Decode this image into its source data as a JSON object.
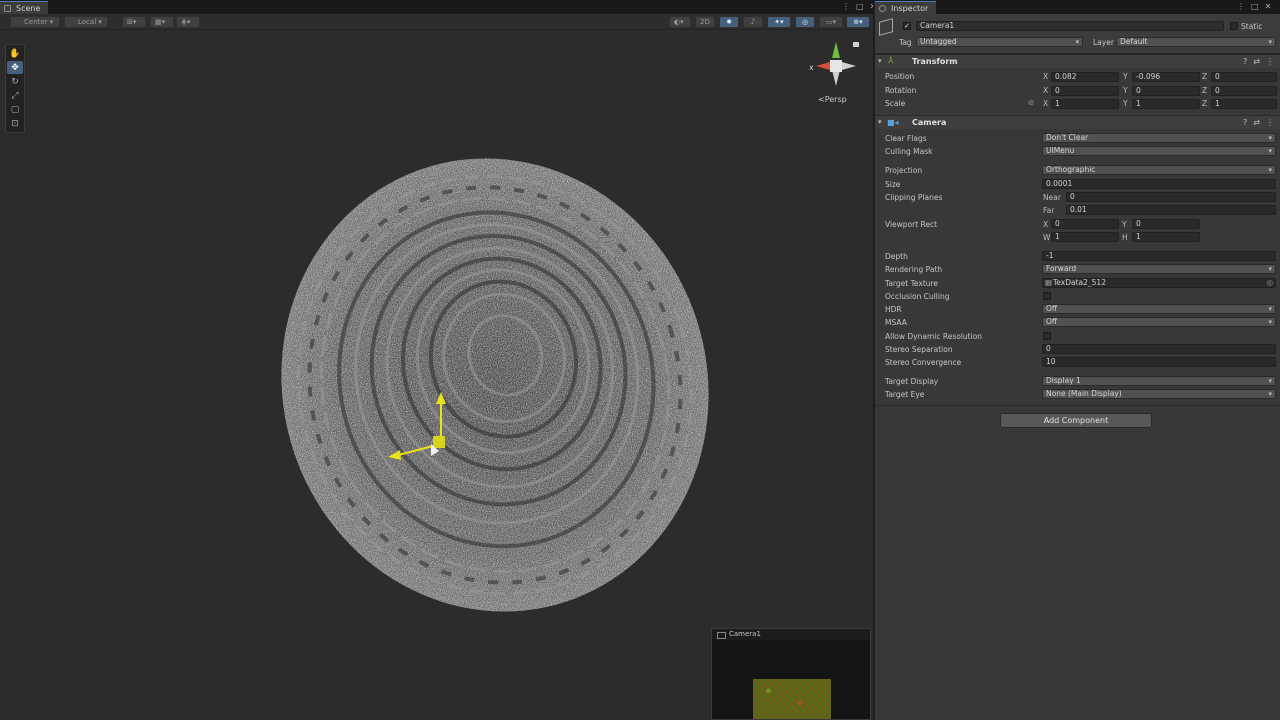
{
  "scene": {
    "tab_label": "Scene",
    "pivot_mode": "Center",
    "pivot_space": "Local",
    "btn_2d": "2D",
    "persp_label": "Persp",
    "gizmo_axis_x": "x"
  },
  "preview": {
    "title": "Camera1"
  },
  "inspector": {
    "tab_label": "Inspector",
    "object_name": "Camera1",
    "static_label": "Static",
    "tag_label": "Tag",
    "tag_value": "Untagged",
    "layer_label": "Layer",
    "layer_value": "Default",
    "transform": {
      "title": "Transform",
      "position_label": "Position",
      "rotation_label": "Rotation",
      "scale_label": "Scale",
      "position": {
        "x": "0.082",
        "y": "-0.096",
        "z": "0"
      },
      "rotation": {
        "x": "0",
        "y": "0",
        "z": "0"
      },
      "scale": {
        "x": "1",
        "y": "1",
        "z": "1"
      }
    },
    "camera": {
      "title": "Camera",
      "clear_flags_label": "Clear Flags",
      "clear_flags": "Don't Clear",
      "culling_mask_label": "Culling Mask",
      "culling_mask": "UIMenu",
      "projection_label": "Projection",
      "projection": "Orthographic",
      "size_label": "Size",
      "size": "0.0001",
      "clipping_label": "Clipping Planes",
      "near_label": "Near",
      "near": "0",
      "far_label": "Far",
      "far": "0.01",
      "viewport_label": "Viewport Rect",
      "vp_x": "0",
      "vp_y": "0",
      "vp_w": "1",
      "vp_h": "1",
      "depth_label": "Depth",
      "depth": "-1",
      "rendering_path_label": "Rendering Path",
      "rendering_path": "Forward",
      "target_texture_label": "Target Texture",
      "target_texture": "TexData2_512",
      "occlusion_label": "Occlusion Culling",
      "hdr_label": "HDR",
      "hdr": "Off",
      "msaa_label": "MSAA",
      "msaa": "Off",
      "dynres_label": "Allow Dynamic Resolution",
      "stereo_sep_label": "Stereo Separation",
      "stereo_sep": "0",
      "stereo_conv_label": "Stereo Convergence",
      "stereo_conv": "10",
      "target_display_label": "Target Display",
      "target_display": "Display 1",
      "target_eye_label": "Target Eye",
      "target_eye": "None (Main Display)"
    },
    "add_component": "Add Component"
  },
  "colors": {
    "accent": "#46607c",
    "gizmo_yellow": "#e8e21a",
    "gizmo_red": "#d9503a",
    "gizmo_green": "#6fbf3f"
  }
}
